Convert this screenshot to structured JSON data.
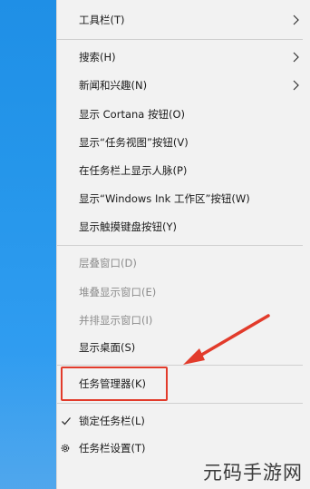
{
  "menu": {
    "items": [
      {
        "label": "工具栏(T)"
      },
      {
        "label": "搜索(H)"
      },
      {
        "label": "新闻和兴趣(N)"
      },
      {
        "label": "显示 Cortana 按钮(O)"
      },
      {
        "label": "显示“任务视图”按钮(V)"
      },
      {
        "label": "在任务栏上显示人脉(P)"
      },
      {
        "label": "显示“Windows Ink 工作区”按钮(W)"
      },
      {
        "label": "显示触摸键盘按钮(Y)"
      },
      {
        "label": "层叠窗口(D)"
      },
      {
        "label": "堆叠显示窗口(E)"
      },
      {
        "label": "并排显示窗口(I)"
      },
      {
        "label": "显示桌面(S)"
      },
      {
        "label": "任务管理器(K)"
      },
      {
        "label": "锁定任务栏(L)"
      },
      {
        "label": "任务栏设置(T)"
      }
    ]
  },
  "watermark": {
    "text": "元码手游网"
  },
  "colors": {
    "accent_red": "#e23b2b",
    "desktop_blue": "#2596ea"
  },
  "icons": {
    "submenu": "chevron-right-icon",
    "checked": "check-icon",
    "settings": "gear-icon"
  }
}
